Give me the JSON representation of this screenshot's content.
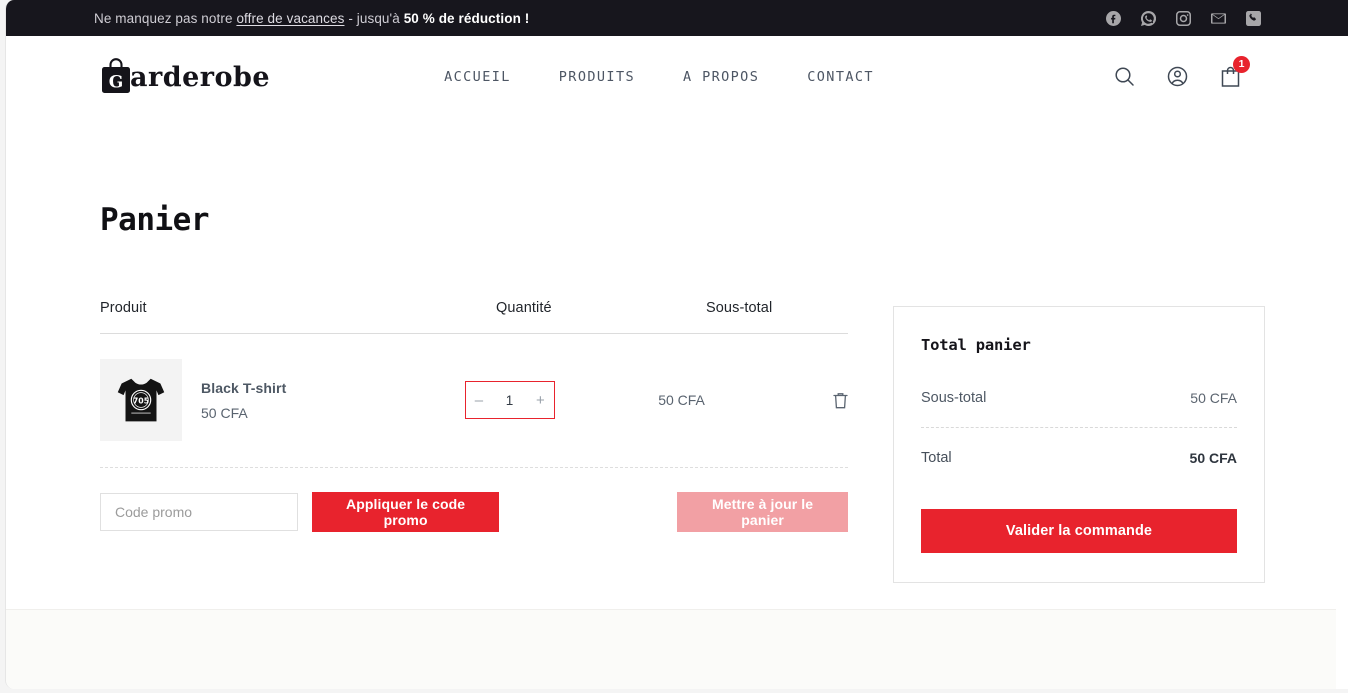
{
  "announcement": {
    "prefix": "Ne manquez pas notre ",
    "link": "offre de vacances",
    "middle": " - jusqu'à ",
    "strong": "50 % de réduction !",
    "social": [
      {
        "name": "facebook-icon"
      },
      {
        "name": "whatsapp-icon"
      },
      {
        "name": "instagram-icon"
      },
      {
        "name": "email-icon"
      },
      {
        "name": "phone-icon"
      }
    ]
  },
  "header": {
    "brand_letter": "G",
    "brand_word": "arderobe",
    "nav": [
      {
        "label": "ACCUEIL"
      },
      {
        "label": "PRODUITS"
      },
      {
        "label": "A PROPOS"
      },
      {
        "label": "CONTACT"
      }
    ],
    "actions": {
      "search": "search-icon",
      "account": "account-icon",
      "cart": "shopping-bag-icon",
      "cart_count": "1"
    }
  },
  "cart": {
    "title": "Panier",
    "columns": {
      "product": "Produit",
      "quantity": "Quantité",
      "subtotal": "Sous-total"
    },
    "items": [
      {
        "name": "Black T-shirt",
        "price": "50 CFA",
        "quantity": "1",
        "subtotal": "50 CFA",
        "thumb_text": "705",
        "decrease_label": "–",
        "increase_label": "+",
        "remove_label": "trash-icon"
      }
    ],
    "promo": {
      "placeholder": "Code promo",
      "value": "",
      "apply_label": "Appliquer le code promo"
    },
    "update_label": "Mettre à jour le panier"
  },
  "totals": {
    "title": "Total panier",
    "rows": [
      {
        "label": "Sous-total",
        "value": "50 CFA"
      },
      {
        "label": "Total",
        "value": "50 CFA"
      }
    ],
    "checkout_label": "Valider la commande"
  },
  "colors": {
    "accent_red": "#e8232d",
    "accent_red_muted": "#f2a0a4",
    "banner_dark": "#17161d",
    "footer_bg": "#fbfbf9"
  }
}
